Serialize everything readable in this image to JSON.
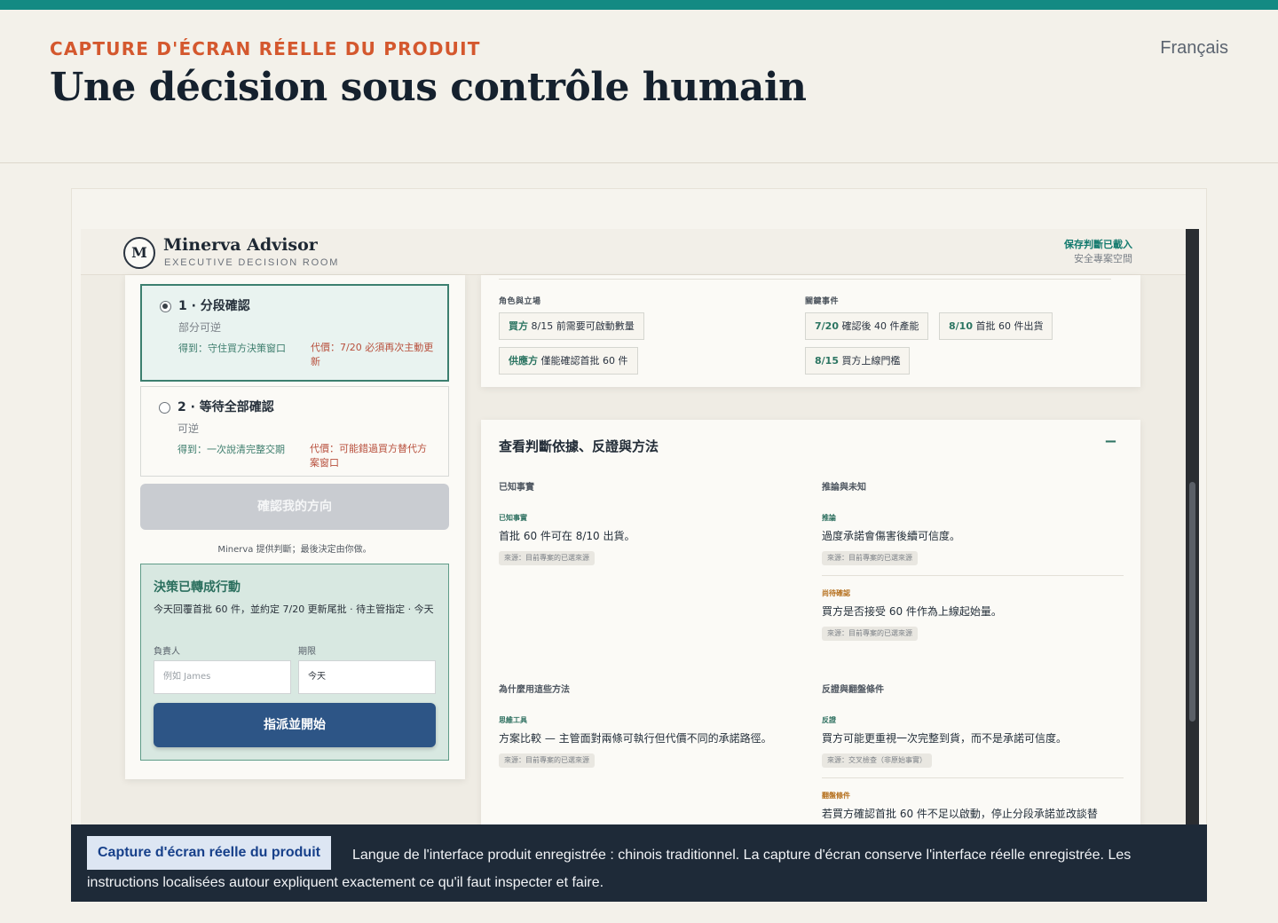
{
  "header": {
    "eyebrow": "CAPTURE D'ÉCRAN RÉELLE DU PRODUIT",
    "title": "Une décision sous contrôle humain",
    "language": "Français"
  },
  "app": {
    "logo_letter": "M",
    "brand": "Minerva Advisor",
    "brand_sub": "EXECUTIVE DECISION ROOM",
    "saved_line1": "保存判斷已載入",
    "saved_line2": "安全專案空間"
  },
  "options": [
    {
      "title": "1 · 分段確認",
      "subtitle": "部分可逆",
      "gain": "得到：守住買方決策窗口",
      "cost": "代價：7/20 必須再次主動更新",
      "selected": true
    },
    {
      "title": "2 · 等待全部確認",
      "subtitle": "可逆",
      "gain": "得到：一次說清完整交期",
      "cost": "代價：可能錯過買方替代方案窗口",
      "selected": false
    }
  ],
  "confirm_button": "確認我的方向",
  "advisor_note": "Minerva 提供判斷；最後決定由你做。",
  "action": {
    "heading": "決策已轉成行動",
    "description": "今天回覆首批 60 件，並約定 7/20 更新尾批 · 待主管指定 · 今天",
    "owner_label": "負責人",
    "owner_placeholder": "例如 James",
    "deadline_label": "期限",
    "deadline_value": "今天",
    "assign_button": "指派並開始"
  },
  "roles": {
    "label": "角色與立場",
    "chips": [
      {
        "key": "買方",
        "text": "8/15 前需要可啟動數量"
      },
      {
        "key": "供應方",
        "text": "僅能確認首批 60 件"
      }
    ]
  },
  "events": {
    "label": "關鍵事件",
    "chips": [
      {
        "key": "7/20",
        "text": "確認後 40 件產能"
      },
      {
        "key": "8/10",
        "text": "首批 60 件出貨"
      },
      {
        "key": "8/15",
        "text": "買方上線門檻"
      }
    ]
  },
  "evidence": {
    "title": "查看判斷依據、反證與方法",
    "collapse_symbol": "−",
    "known_heading": "已知事實",
    "known_tag": "已知事實",
    "known_text": "首批 60 件可在 8/10 出貨。",
    "known_source": "來源：目前專案的已選來源",
    "inference_heading": "推論與未知",
    "inference_tag": "推論",
    "inference_text": "過度承諾會傷害後續可信度。",
    "inference_source": "來源：目前專案的已選來源",
    "pending_tag": "尚待確認",
    "pending_text": "買方是否接受 60 件作為上線起始量。",
    "pending_source": "來源：目前專案的已選來源",
    "method_heading": "為什麼用這些方法",
    "method_tag": "思維工具",
    "method_text": "方案比較 — 主管面對兩條可執行但代價不同的承諾路徑。",
    "method_source": "來源：目前專案的已選來源",
    "counter_heading": "反證與翻盤條件",
    "counter_tag": "反證",
    "counter_text": "買方可能更重視一次完整到貨，而不是承諾可信度。",
    "counter_source": "來源：交叉檢查（非原始事實）",
    "flip_tag": "翻盤條件",
    "flip_text": "若買方確認首批 60 件不足以啟動，停止分段承諾並改談替"
  },
  "caption": {
    "badge": "Capture d'écran réelle du produit",
    "text": "Langue de l'interface produit enregistrée : chinois traditionnel. La capture d'écran conserve l'interface réelle enregistrée. Les instructions localisées autour expliquent exactement ce qu'il faut inspecter et faire."
  }
}
